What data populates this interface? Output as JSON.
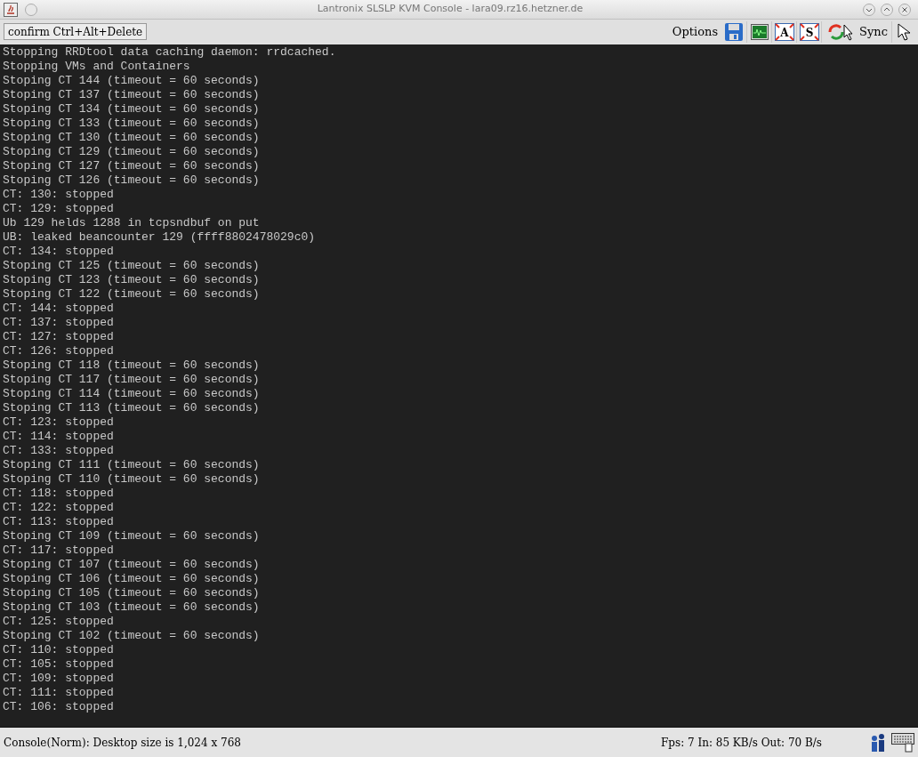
{
  "window": {
    "title": "Lantronix SLSLP KVM Console - lara09.rz16.hetzner.de"
  },
  "toolbar": {
    "button": "confirm Ctrl+Alt+Delete",
    "options_label": "Options",
    "sync_label": "Sync",
    "icon_letters": [
      "A",
      "S"
    ]
  },
  "console_lines": [
    "Stopping RRDtool data caching daemon: rrdcached.",
    "Stopping VMs and Containers",
    "Stoping CT 144 (timeout = 60 seconds)",
    "Stoping CT 137 (timeout = 60 seconds)",
    "Stoping CT 134 (timeout = 60 seconds)",
    "Stoping CT 133 (timeout = 60 seconds)",
    "Stoping CT 130 (timeout = 60 seconds)",
    "Stoping CT 129 (timeout = 60 seconds)",
    "Stoping CT 127 (timeout = 60 seconds)",
    "Stoping CT 126 (timeout = 60 seconds)",
    "CT: 130: stopped",
    "CT: 129: stopped",
    "Ub 129 helds 1288 in tcpsndbuf on put",
    "UB: leaked beancounter 129 (ffff8802478029c0)",
    "CT: 134: stopped",
    "Stoping CT 125 (timeout = 60 seconds)",
    "Stoping CT 123 (timeout = 60 seconds)",
    "Stoping CT 122 (timeout = 60 seconds)",
    "CT: 144: stopped",
    "CT: 137: stopped",
    "CT: 127: stopped",
    "CT: 126: stopped",
    "Stoping CT 118 (timeout = 60 seconds)",
    "Stoping CT 117 (timeout = 60 seconds)",
    "Stoping CT 114 (timeout = 60 seconds)",
    "Stoping CT 113 (timeout = 60 seconds)",
    "CT: 123: stopped",
    "CT: 114: stopped",
    "CT: 133: stopped",
    "Stoping CT 111 (timeout = 60 seconds)",
    "Stoping CT 110 (timeout = 60 seconds)",
    "CT: 118: stopped",
    "CT: 122: stopped",
    "CT: 113: stopped",
    "Stoping CT 109 (timeout = 60 seconds)",
    "CT: 117: stopped",
    "Stoping CT 107 (timeout = 60 seconds)",
    "Stoping CT 106 (timeout = 60 seconds)",
    "Stoping CT 105 (timeout = 60 seconds)",
    "Stoping CT 103 (timeout = 60 seconds)",
    "CT: 125: stopped",
    "Stoping CT 102 (timeout = 60 seconds)",
    "CT: 110: stopped",
    "CT: 105: stopped",
    "CT: 109: stopped",
    "CT: 111: stopped",
    "CT: 106: stopped"
  ],
  "status_bar": {
    "left": "Console(Norm): Desktop size is 1,024 x 768",
    "right": "Fps: 7 In: 85 KB/s Out: 70 B/s"
  }
}
